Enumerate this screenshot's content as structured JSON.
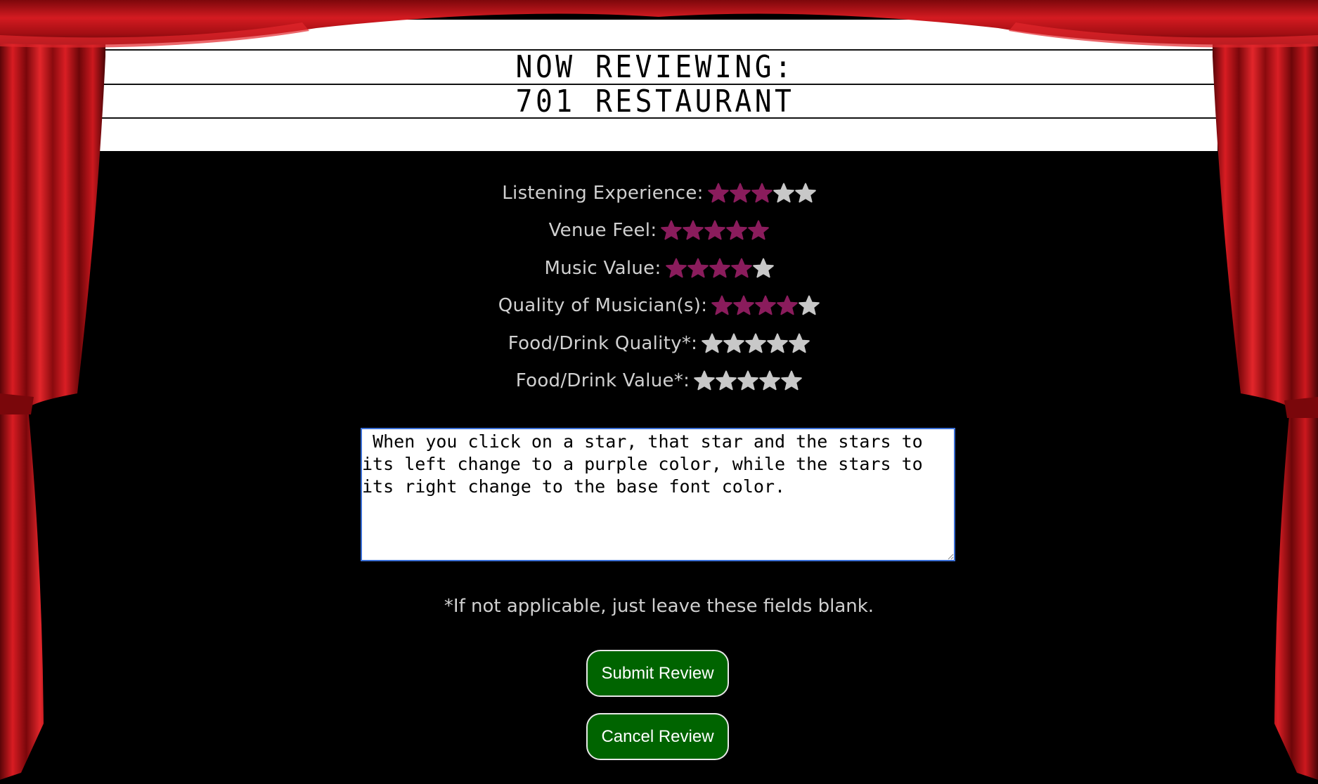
{
  "marquee": {
    "line1": "NOW REVIEWING:",
    "line2": "701 RESTAURANT"
  },
  "ratings": [
    {
      "label": "Listening Experience:",
      "rating": 3,
      "max": 5
    },
    {
      "label": "Venue Feel:",
      "rating": 5,
      "max": 5
    },
    {
      "label": "Music Value:",
      "rating": 4,
      "max": 5
    },
    {
      "label": "Quality of Musician(s):",
      "rating": 4,
      "max": 5
    },
    {
      "label": "Food/Drink Quality*:",
      "rating": 0,
      "max": 5
    },
    {
      "label": "Food/Drink Value*:",
      "rating": 0,
      "max": 5
    }
  ],
  "review": {
    "text": " When you click on a star, that star and the stars to its left change to a purple color, while the stars to its right change to the base font color."
  },
  "note": "*If not applicable, just leave these fields blank.",
  "buttons": {
    "submit": "Submit Review",
    "cancel": "Cancel Review"
  },
  "colors": {
    "star_active": "#8a1c5c",
    "star_inactive": "#c8c8c8",
    "button_bg": "#006400",
    "curtain": "#c8151b",
    "background": "#000000"
  },
  "icons": {
    "star": "star-icon",
    "curtain": "theater-curtain"
  }
}
